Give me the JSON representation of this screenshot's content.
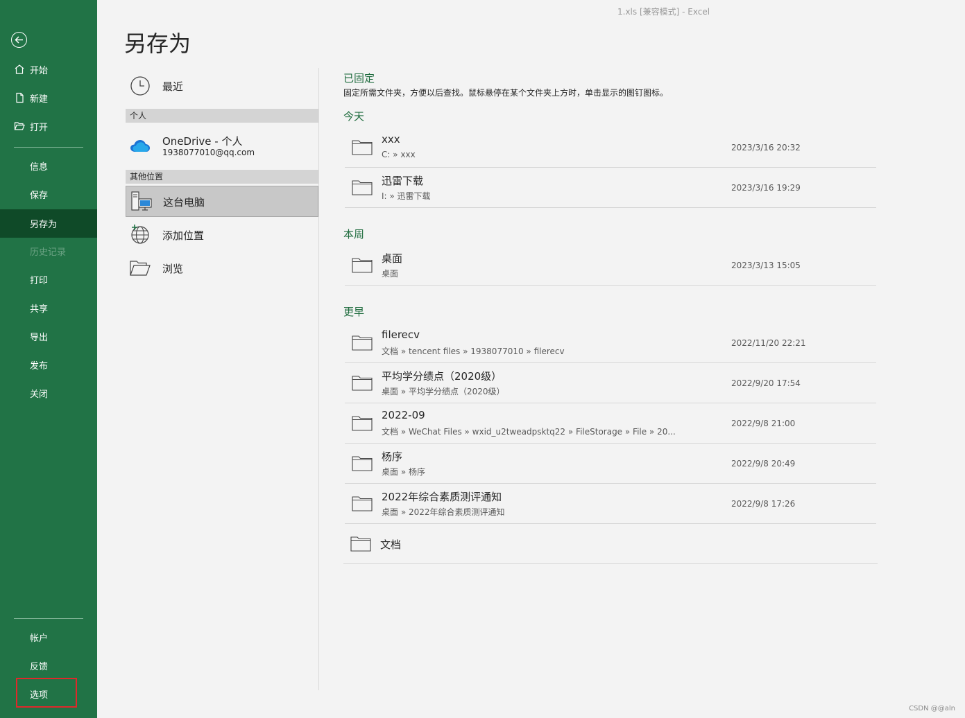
{
  "window": {
    "title": "1.xls  [兼容模式]  -   Excel"
  },
  "page": {
    "title": "另存为"
  },
  "sidebar": {
    "items": [
      {
        "label": "开始"
      },
      {
        "label": "新建"
      },
      {
        "label": "打开"
      },
      {
        "label": "信息"
      },
      {
        "label": "保存"
      },
      {
        "label": "另存为",
        "active": true
      },
      {
        "label": "历史记录",
        "disabled": true
      },
      {
        "label": "打印"
      },
      {
        "label": "共享"
      },
      {
        "label": "导出"
      },
      {
        "label": "发布"
      },
      {
        "label": "关闭"
      }
    ],
    "bottom": [
      {
        "label": "帐户"
      },
      {
        "label": "反馈"
      },
      {
        "label": "选项",
        "highlighted": true
      }
    ]
  },
  "locations": {
    "recent": "最近",
    "personal_header": "个人",
    "onedrive": {
      "name": "OneDrive - 个人",
      "email": "1938077010@qq.com"
    },
    "other_header": "其他位置",
    "this_pc": "这台电脑",
    "add_place": "添加位置",
    "browse": "浏览"
  },
  "pinned": {
    "title": "已固定",
    "desc": "固定所需文件夹，方便以后查找。鼠标悬停在某个文件夹上方时，单击显示的图钉图标。"
  },
  "groups": {
    "today": "今天",
    "week": "本周",
    "earlier": "更早"
  },
  "folders": {
    "today": [
      {
        "name": "xxx",
        "path": "C: » xxx",
        "date": "2023/3/16 20:32"
      },
      {
        "name": "迅雷下载",
        "path": "I: » 迅雷下载",
        "date": "2023/3/16 19:29"
      }
    ],
    "week": [
      {
        "name": "桌面",
        "path": "桌面",
        "date": "2023/3/13 15:05"
      }
    ],
    "earlier": [
      {
        "name": "filerecv",
        "path": "文档 » tencent files » 1938077010 » filerecv",
        "date": "2022/11/20 22:21"
      },
      {
        "name": "平均学分绩点（2020级）",
        "path": "桌面 » 平均学分绩点（2020级）",
        "date": "2022/9/20 17:54"
      },
      {
        "name": "2022-09",
        "path": "文档 » WeChat Files » wxid_u2tweadpsktq22 » FileStorage » File » 20...",
        "date": "2022/9/8 21:00"
      },
      {
        "name": "杨序",
        "path": "桌面 » 杨序",
        "date": "2022/9/8 20:49"
      },
      {
        "name": "2022年综合素质测评通知",
        "path": "桌面 » 2022年综合素质测评通知",
        "date": "2022/9/8 17:26"
      }
    ],
    "documents": {
      "name": "文档"
    }
  },
  "colors": {
    "brand": "#217346",
    "active": "#0f4a28",
    "highlight": "#e0282a"
  },
  "watermark": "CSDN @@aln"
}
